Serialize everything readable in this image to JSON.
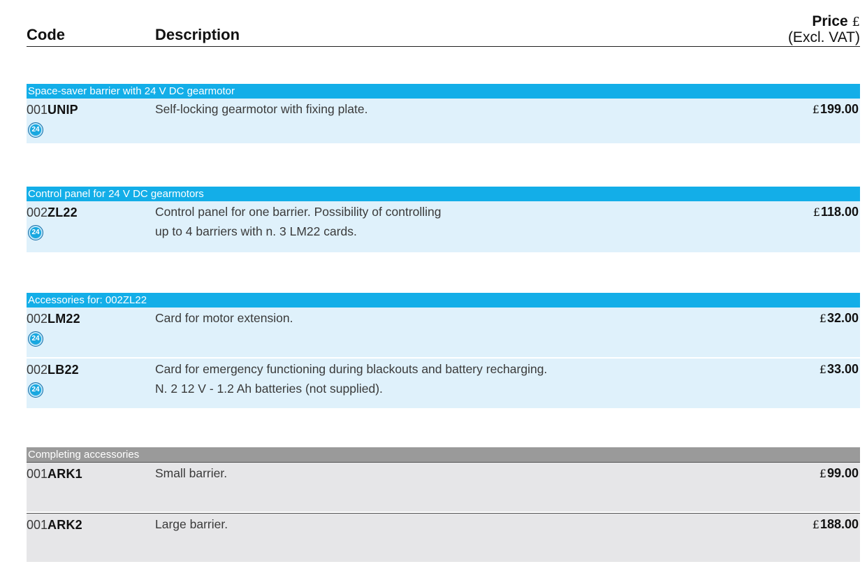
{
  "header": {
    "code": "Code",
    "description": "Description",
    "price_label": "Price",
    "price_currency": "£",
    "price_sub": "(Excl. VAT)"
  },
  "sections": [
    {
      "title": "Space-saver barrier with 24 V DC gearmotor",
      "items": [
        {
          "code_prefix": "001",
          "code_suffix": "UNIP",
          "description_1": "Self-locking gearmotor with fixing plate.",
          "description_2": "",
          "currency": "£",
          "price": "199.00",
          "badge": "24"
        }
      ]
    },
    {
      "title": "Control panel for 24 V DC gearmotors",
      "items": [
        {
          "code_prefix": "002",
          "code_suffix": "ZL22",
          "description_1": "Control panel for one barrier. Possibility of controlling",
          "description_2": "up to 4 barriers with n. 3 LM22 cards.",
          "currency": "£",
          "price": "118.00",
          "badge": "24"
        }
      ]
    },
    {
      "title": "Accessories for: 002ZL22",
      "items": [
        {
          "code_prefix": "002",
          "code_suffix": "LM22",
          "description_1": "Card for motor extension.",
          "description_2": "",
          "currency": "£",
          "price": "32.00",
          "badge": "24"
        },
        {
          "code_prefix": "002",
          "code_suffix": "LB22",
          "description_1": "Card for emergency functioning during blackouts and battery recharging.",
          "description_2": "N. 2 12 V - 1.2 Ah batteries (not supplied).",
          "currency": "£",
          "price": "33.00",
          "badge": "24"
        }
      ]
    },
    {
      "title": "Completing accessories",
      "items": [
        {
          "code_prefix": "001",
          "code_suffix": "ARK1",
          "description_1": "Small barrier.",
          "description_2": "",
          "currency": "£",
          "price": "99.00"
        },
        {
          "code_prefix": "001",
          "code_suffix": "ARK2",
          "description_1": "Large barrier.",
          "description_2": "",
          "currency": "£",
          "price": "188.00"
        }
      ]
    }
  ]
}
